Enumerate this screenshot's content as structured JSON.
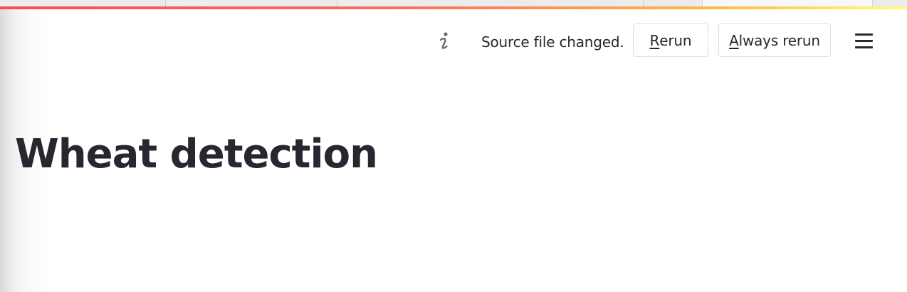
{
  "header": {
    "icons": {
      "info": "info-icon",
      "menu": "hamburger-menu-icon"
    },
    "status_text": "Source file changed.",
    "rerun": {
      "accelerator": "R",
      "rest": "erun"
    },
    "always_rerun": {
      "accelerator": "A",
      "rest": "lways rerun"
    },
    "decoration_colors": [
      "#ff4b4b",
      "#ffbd45",
      "#fffd80"
    ]
  },
  "main": {
    "title": "Wheat detection"
  }
}
